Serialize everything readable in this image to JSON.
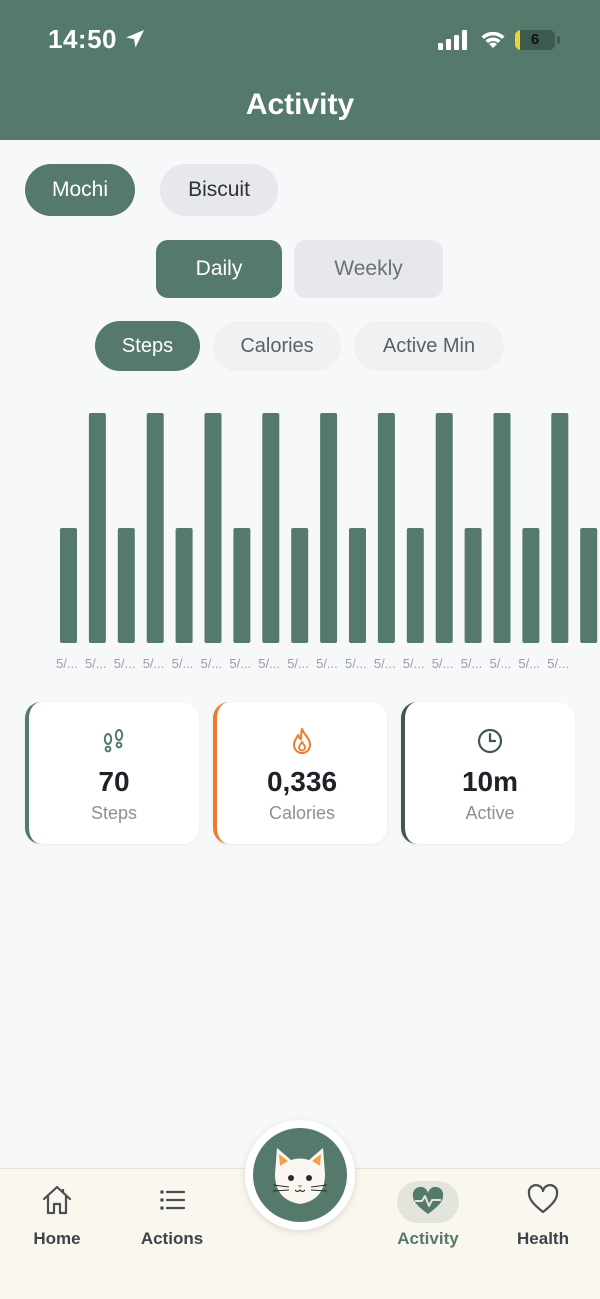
{
  "status_bar": {
    "time": "14:50",
    "battery": "6"
  },
  "header": {
    "title": "Activity"
  },
  "pets": [
    {
      "label": "Mochi",
      "selected": true
    },
    {
      "label": "Biscuit",
      "selected": false
    }
  ],
  "period_tabs": [
    {
      "label": "Daily",
      "selected": true
    },
    {
      "label": "Weekly",
      "selected": false
    }
  ],
  "metric_tabs": [
    {
      "label": "Steps",
      "selected": true
    },
    {
      "label": "Calories",
      "selected": false
    },
    {
      "label": "Active Min",
      "selected": false
    }
  ],
  "chart_data": {
    "type": "bar",
    "categories": [
      "5/...",
      "5/...",
      "5/...",
      "5/...",
      "5/...",
      "5/...",
      "5/...",
      "5/...",
      "5/...",
      "5/...",
      "5/...",
      "5/...",
      "5/...",
      "5/...",
      "5/...",
      "5/...",
      "5/...",
      "5/..."
    ],
    "values": [
      1,
      2,
      1,
      2,
      1,
      2,
      1,
      2,
      1,
      2,
      1,
      2,
      1,
      2,
      1,
      2,
      1,
      2,
      1
    ],
    "bar_color": "#55796b",
    "grid": false,
    "title": "",
    "xlabel": "",
    "ylabel": ""
  },
  "stats": [
    {
      "icon": "paw-prints-icon",
      "value": "70",
      "label": "Steps",
      "accent": "#55796b"
    },
    {
      "icon": "flame-icon",
      "value": "0,336",
      "label": "Calories",
      "accent": "#f07a2a"
    },
    {
      "icon": "clock-icon",
      "value": "10m",
      "label": "Active",
      "accent": "#3d5a4f"
    }
  ],
  "tabbar": {
    "home": "Home",
    "actions": "Actions",
    "activity": "Activity",
    "health": "Health"
  },
  "colors": {
    "primary": "#55796b",
    "calories_accent": "#f07a2a",
    "background": "#f7f8fa",
    "tabbar_bg": "#faf7ef"
  }
}
